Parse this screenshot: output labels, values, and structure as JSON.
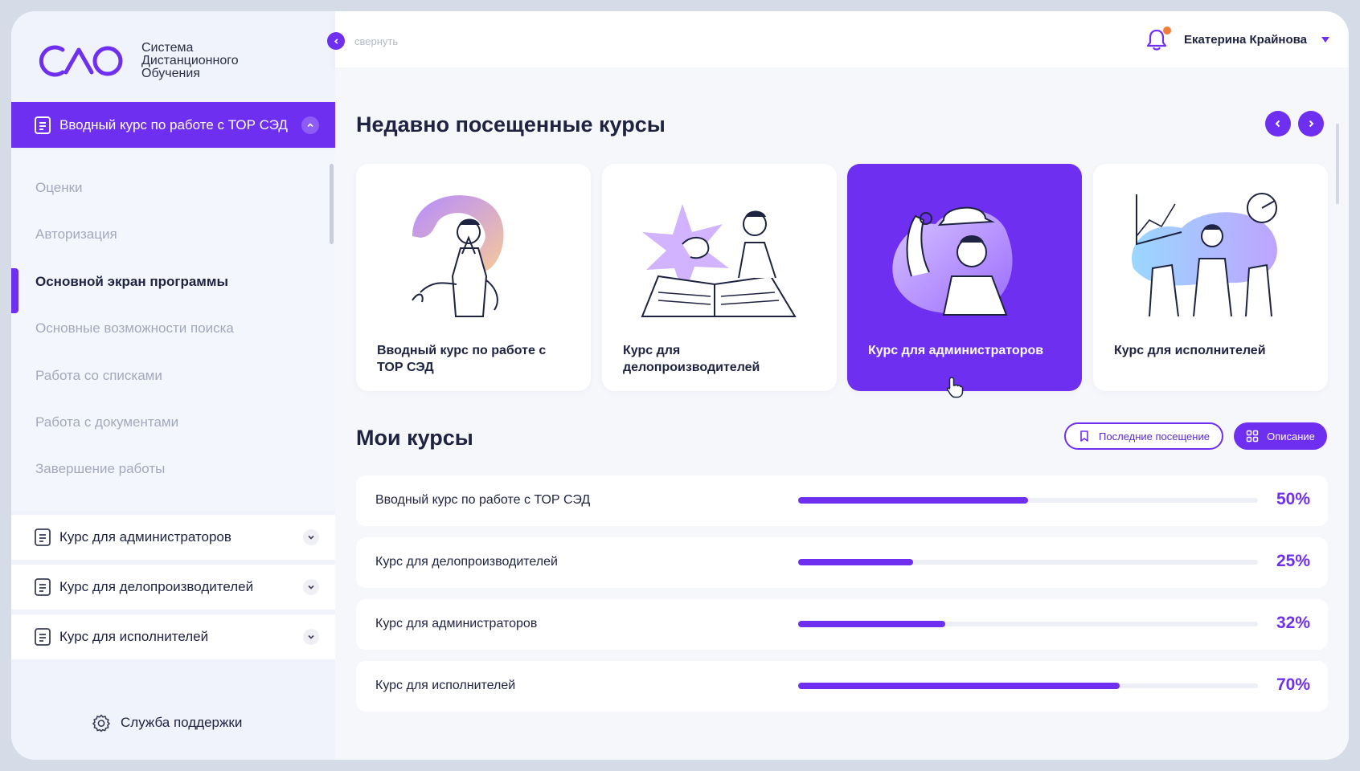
{
  "logo": {
    "mark": "САО",
    "lines": [
      "Система",
      "Дистанционного",
      "Обучения"
    ]
  },
  "sidebar": {
    "current_course": "Вводный курс по работе с ТОР СЭД",
    "lessons": [
      {
        "label": "Оценки",
        "active": false
      },
      {
        "label": "Авторизация",
        "active": false
      },
      {
        "label": "Основной экран программы",
        "active": true
      },
      {
        "label": "Основные возможности поиска",
        "active": false
      },
      {
        "label": "Работа со списками",
        "active": false
      },
      {
        "label": "Работа с документами",
        "active": false
      },
      {
        "label": "Завершение работы",
        "active": false
      }
    ],
    "courses": [
      "Курс для администраторов",
      "Курс для делопроизводителей",
      "Курс для исполнителей"
    ],
    "support_label": "Служба поддержки"
  },
  "topbar": {
    "collapse_label": "свернуть",
    "user_name": "Екатерина Крайнова"
  },
  "recent": {
    "title": "Недавно посещенные курсы",
    "cards": [
      {
        "label": "Вводный курс по работе с ТОР СЭД",
        "active": false,
        "icon": "thinking-person-illustration"
      },
      {
        "label": "Курс для делопроизводителей",
        "active": false,
        "icon": "reading-book-illustration"
      },
      {
        "label": "Курс для администраторов",
        "active": true,
        "icon": "admin-hat-illustration"
      },
      {
        "label": "Курс для исполнителей",
        "active": false,
        "icon": "team-presentation-illustration"
      }
    ]
  },
  "my_courses": {
    "title": "Мои курсы",
    "btn_last_visit": "Последние посещение",
    "btn_description": "Описание",
    "rows": [
      {
        "name": "Вводный курс по работе с ТОР СЭД",
        "progress": 50,
        "pct_label": "50%"
      },
      {
        "name": "Курс для делопроизводителей",
        "progress": 25,
        "pct_label": "25%"
      },
      {
        "name": "Курс для администраторов",
        "progress": 32,
        "pct_label": "32%"
      },
      {
        "name": "Курс для исполнителей",
        "progress": 70,
        "pct_label": "70%"
      }
    ]
  },
  "colors": {
    "accent": "#6e2ff1",
    "notification": "#f27c3a"
  }
}
